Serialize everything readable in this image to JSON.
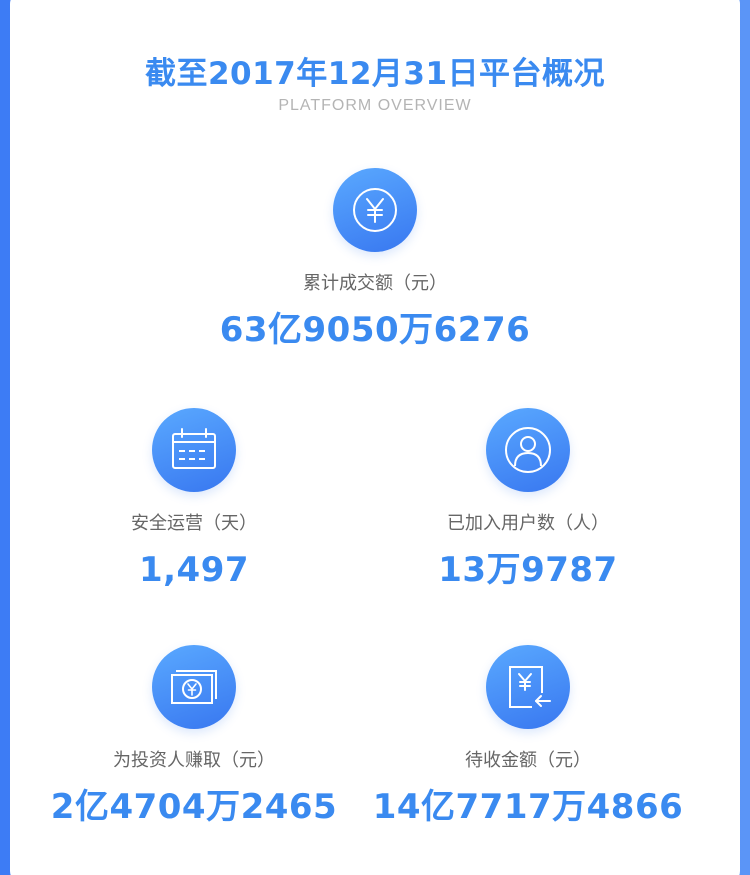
{
  "header": {
    "title": "截至2017年12月31日平台概况",
    "subtitle": "PLATFORM OVERVIEW"
  },
  "stats": {
    "total_volume": {
      "icon": "yen-circle-icon",
      "label": "累计成交额（元）",
      "value": "63亿9050万6276"
    },
    "safe_days": {
      "icon": "calendar-icon",
      "label": "安全运营（天）",
      "value": "1,497"
    },
    "users": {
      "icon": "user-icon",
      "label": "已加入用户数（人）",
      "value": "13万9787"
    },
    "earnings": {
      "icon": "banknote-icon",
      "label": "为投资人赚取（元）",
      "value": "2亿4704万2465"
    },
    "pending": {
      "icon": "yen-receive-icon",
      "label": "待收金额（元）",
      "value": "14亿7717万4866"
    }
  },
  "colors": {
    "accent": "#3a8af0",
    "background": "#3d7cf5",
    "label": "#666666",
    "subtitle": "#b4b4b4"
  }
}
